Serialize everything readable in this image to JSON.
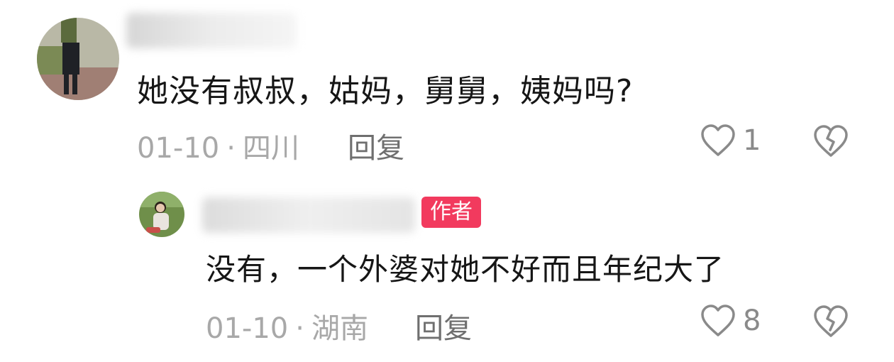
{
  "comments": [
    {
      "text": "她没有叔叔，姑妈，舅舅，姨妈吗?",
      "date": "01-10",
      "location": "四川",
      "reply_label": "回复",
      "likes": "1"
    }
  ],
  "replies": [
    {
      "badge": "作者",
      "text": "没有，一个外婆对她不好而且年纪大了",
      "date": "01-10",
      "location": "湖南",
      "reply_label": "回复",
      "likes": "8"
    }
  ],
  "separator": "·",
  "icons": {
    "like": "heart-outline-icon",
    "dislike": "broken-heart-icon"
  },
  "colors": {
    "badge": "#f23a5e",
    "meta": "#a8a8a8",
    "text": "#161616"
  }
}
